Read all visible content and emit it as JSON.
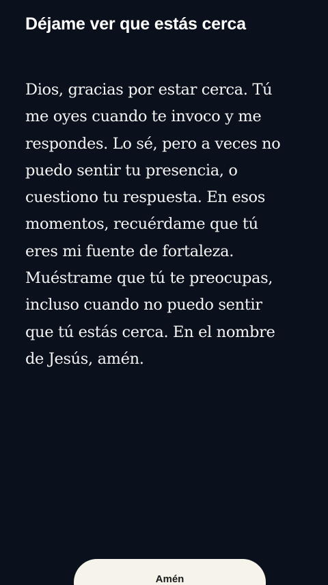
{
  "header": {
    "title": "Déjame ver que estás cerca"
  },
  "prayer": {
    "lines": [
      "Dios, gracias por estar cerca. Tú",
      "me oyes cuando te invoco y me",
      "respondes. Lo sé, pero a veces no",
      "puedo sentir tu presencia, o",
      "cuestiono tu respuesta. En esos",
      "momentos, recuérdame que tú",
      "eres mi fuente de fortaleza.",
      "Muéstrame que tú te preocupas,",
      "incluso cuando no puedo sentir",
      "que tú estás cerca. En el nombre",
      "de Jesús, amén."
    ]
  },
  "footer": {
    "amen_label": "Amén"
  },
  "colors": {
    "background": "#0b111c",
    "text": "#f4f4f4",
    "button_background": "#f6f3ea",
    "button_text": "#1a1a1a"
  }
}
